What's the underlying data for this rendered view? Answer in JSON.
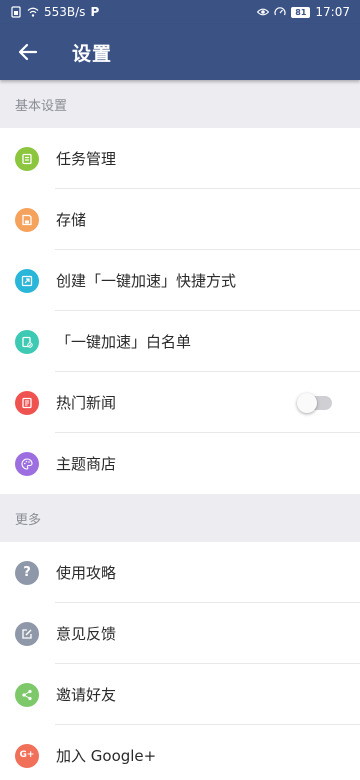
{
  "status_bar": {
    "net_speed": "553B/s",
    "battery": "81",
    "time": "17:07"
  },
  "app_bar": {
    "title": "设置"
  },
  "sections": [
    {
      "header": "基本设置",
      "items": [
        {
          "label": "任务管理",
          "icon": "task-list-icon",
          "color": "#8cc63f"
        },
        {
          "label": "存储",
          "icon": "storage-icon",
          "color": "#f5a25d"
        },
        {
          "label": "创建「一键加速」快捷方式",
          "icon": "shortcut-icon",
          "color": "#29b6d8"
        },
        {
          "label": "「一键加速」白名单",
          "icon": "whitelist-icon",
          "color": "#3dc9b3"
        },
        {
          "label": "热门新闻",
          "icon": "news-icon",
          "color": "#ef5350",
          "toggle": false
        },
        {
          "label": "主题商店",
          "icon": "theme-palette-icon",
          "color": "#9c6ee0"
        }
      ]
    },
    {
      "header": "更多",
      "items": [
        {
          "label": "使用攻略",
          "icon": "help-icon",
          "color": "#8f98a8"
        },
        {
          "label": "意见反馈",
          "icon": "feedback-icon",
          "color": "#8f98a8"
        },
        {
          "label": "邀请好友",
          "icon": "share-icon",
          "color": "#7dc96a"
        },
        {
          "label": "加入 Google+",
          "icon": "google-plus-icon",
          "color": "#f0705a"
        }
      ]
    }
  ]
}
